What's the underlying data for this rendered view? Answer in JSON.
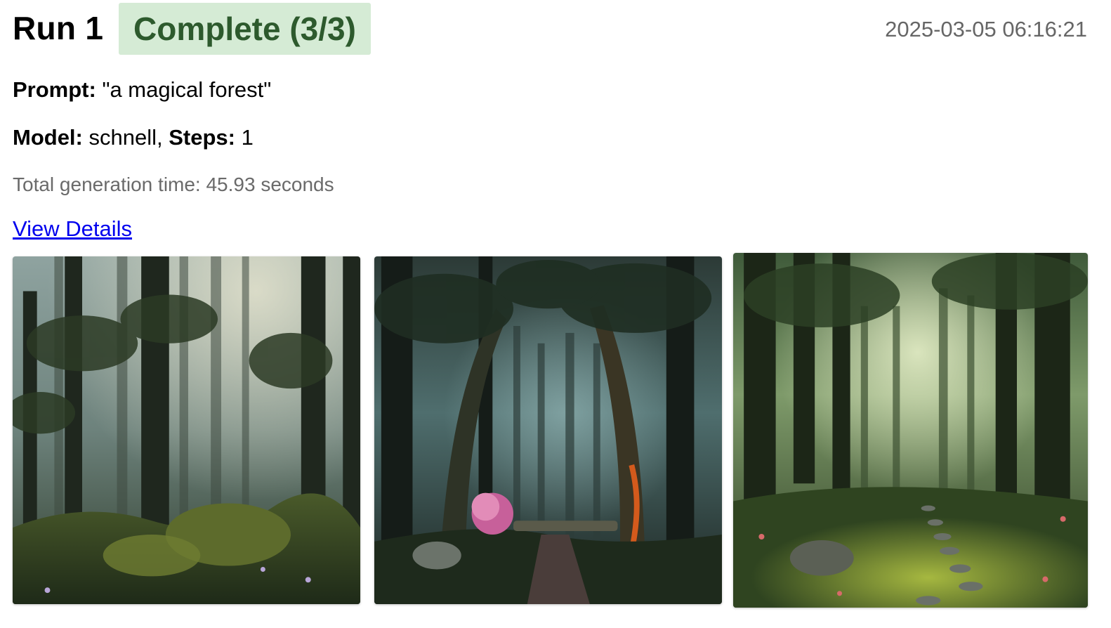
{
  "run": {
    "title": "Run 1",
    "status": "Complete (3/3)",
    "status_bg": "#d5ebd5",
    "status_fg": "#2d5a2d",
    "timestamp": "2025-03-05 06:16:21"
  },
  "details": {
    "prompt_label": "Prompt:",
    "prompt_value": "\"a magical forest\"",
    "model_label": "Model:",
    "model_value": "schnell,",
    "steps_label": "Steps:",
    "steps_value": "1",
    "generation_time": "Total generation time: 45.93 seconds"
  },
  "link": {
    "label": "View Details",
    "color": "#0000ee"
  }
}
